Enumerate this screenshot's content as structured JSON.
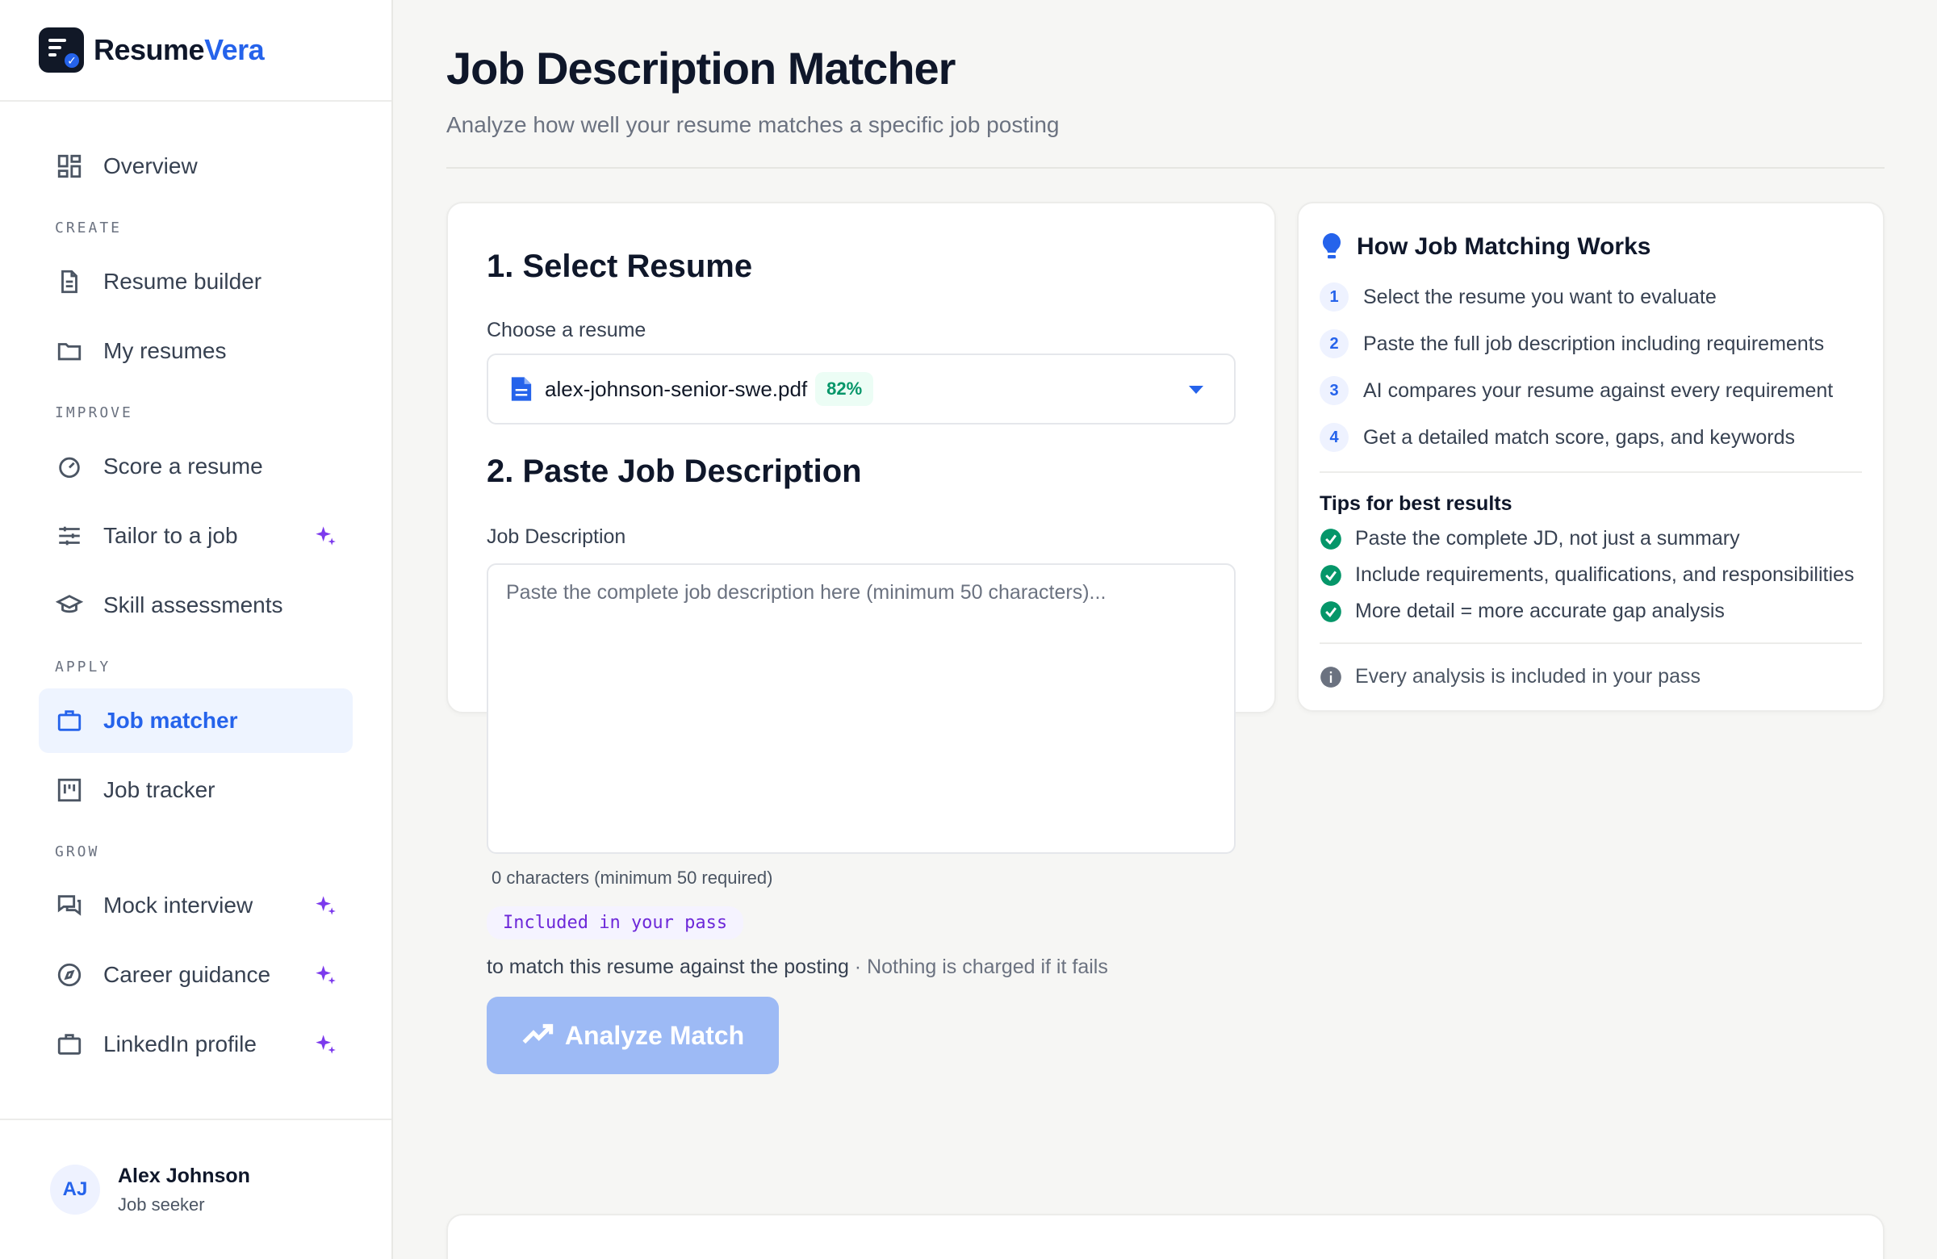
{
  "brand": {
    "name_a": "Resume",
    "name_b": "Vera",
    "logo_icon": "resume-check-icon"
  },
  "nav": {
    "overview": "Overview",
    "sections": {
      "create": "CREATE",
      "improve": "IMPROVE",
      "apply": "APPLY",
      "grow": "GROW"
    },
    "items": {
      "resume_builder": "Resume builder",
      "my_resumes": "My resumes",
      "score_resume": "Score a resume",
      "tailor_job": "Tailor to a job",
      "skill_assessments": "Skill assessments",
      "job_matcher": "Job matcher",
      "job_tracker": "Job tracker",
      "mock_interview": "Mock interview",
      "career_guidance": "Career guidance",
      "linkedin_profile": "LinkedIn profile"
    },
    "active": "job_matcher"
  },
  "user": {
    "initials": "AJ",
    "name": "Alex Johnson",
    "role": "Job seeker"
  },
  "page": {
    "title": "Job Description Matcher",
    "subtitle": "Analyze how well your resume matches a specific job posting"
  },
  "form": {
    "section1_title": "1. Select Resume",
    "choose_label": "Choose a resume",
    "selected_resume": "alex-johnson-senior-swe.pdf",
    "selected_score": "82%",
    "section2_title": "2. Paste Job Description",
    "jd_label": "Job Description",
    "jd_value": "",
    "jd_placeholder": "Paste the complete job description here (minimum 50 characters)...",
    "char_count": "0 characters (minimum 50 required)",
    "pass_chip": "Included in your pass",
    "note_main": "to match this resume against the posting",
    "note_muted": " · Nothing is charged if it fails",
    "analyze_label": "Analyze Match"
  },
  "how": {
    "title": "How Job Matching Works",
    "steps": [
      {
        "num": "1",
        "text": "Select the resume you want to evaluate"
      },
      {
        "num": "2",
        "text": "Paste the full job description including requirements"
      },
      {
        "num": "3",
        "text": "AI compares your resume against every requirement"
      },
      {
        "num": "4",
        "text": "Get a detailed match score, gaps, and keywords"
      }
    ],
    "tips_title": "Tips for best results",
    "tips": [
      "Paste the complete JD, not just a summary",
      "Include requirements, qualifications, and responsibilities",
      "More detail = more accurate gap analysis"
    ],
    "info": "Every analysis is included in your pass"
  },
  "colors": {
    "accent": "#2563eb",
    "success": "#059669",
    "sparkle": "#7c3aed",
    "button_disabled": "#9dbaf5"
  }
}
